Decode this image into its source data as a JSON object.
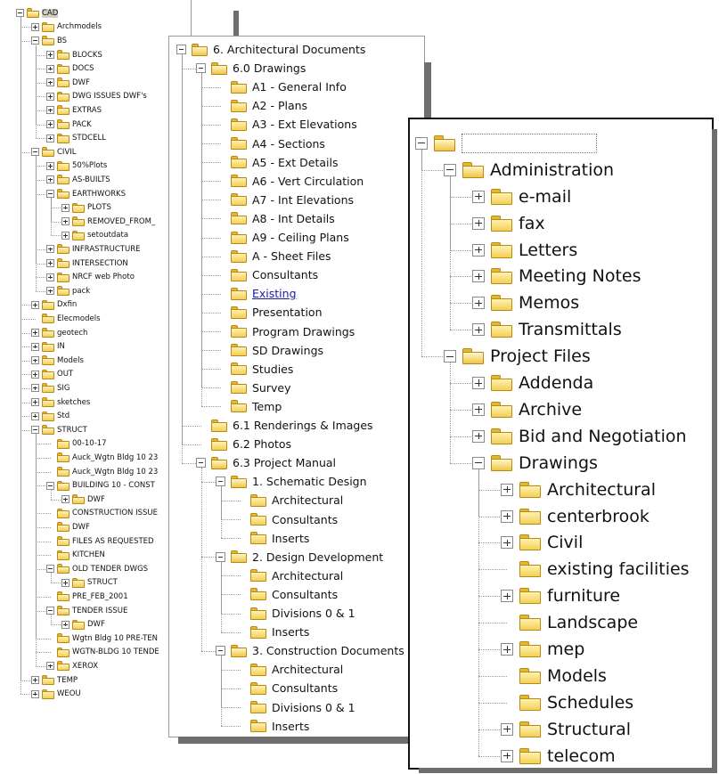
{
  "left_panel": {
    "items": [
      {
        "label": "CAD",
        "depth": 0,
        "toggle": "minus",
        "highlight": true
      },
      {
        "label": "Archmodels",
        "depth": 1,
        "toggle": "plus"
      },
      {
        "label": "BS",
        "depth": 1,
        "toggle": "minus"
      },
      {
        "label": "BLOCKS",
        "depth": 2,
        "toggle": "plus"
      },
      {
        "label": "DOCS",
        "depth": 2,
        "toggle": "plus"
      },
      {
        "label": "DWF",
        "depth": 2,
        "toggle": "plus"
      },
      {
        "label": "DWG ISSUES DWF's",
        "depth": 2,
        "toggle": "plus"
      },
      {
        "label": "EXTRAS",
        "depth": 2,
        "toggle": "plus"
      },
      {
        "label": "PACK",
        "depth": 2,
        "toggle": "plus"
      },
      {
        "label": "STDCELL",
        "depth": 2,
        "toggle": "plus"
      },
      {
        "label": "CIVIL",
        "depth": 1,
        "toggle": "minus"
      },
      {
        "label": "50%Plots",
        "depth": 2,
        "toggle": "plus"
      },
      {
        "label": "AS-BUILTS",
        "depth": 2,
        "toggle": "plus"
      },
      {
        "label": "EARTHWORKS",
        "depth": 2,
        "toggle": "minus"
      },
      {
        "label": "PLOTS",
        "depth": 3,
        "toggle": "plus"
      },
      {
        "label": "REMOVED_FROM_",
        "depth": 3,
        "toggle": "plus"
      },
      {
        "label": "setoutdata",
        "depth": 3,
        "toggle": "plus"
      },
      {
        "label": "INFRASTRUCTURE",
        "depth": 2,
        "toggle": "plus"
      },
      {
        "label": "INTERSECTION",
        "depth": 2,
        "toggle": "plus"
      },
      {
        "label": "NRCF web Photo",
        "depth": 2,
        "toggle": "plus"
      },
      {
        "label": "pack",
        "depth": 2,
        "toggle": "plus"
      },
      {
        "label": "Dxfin",
        "depth": 1,
        "toggle": "plus"
      },
      {
        "label": "Elecmodels",
        "depth": 1,
        "toggle": "none"
      },
      {
        "label": "geotech",
        "depth": 1,
        "toggle": "plus"
      },
      {
        "label": "IN",
        "depth": 1,
        "toggle": "plus"
      },
      {
        "label": "Models",
        "depth": 1,
        "toggle": "plus"
      },
      {
        "label": "OUT",
        "depth": 1,
        "toggle": "plus"
      },
      {
        "label": "SIG",
        "depth": 1,
        "toggle": "plus"
      },
      {
        "label": "sketches",
        "depth": 1,
        "toggle": "plus"
      },
      {
        "label": "Std",
        "depth": 1,
        "toggle": "plus"
      },
      {
        "label": "STRUCT",
        "depth": 1,
        "toggle": "minus"
      },
      {
        "label": "00-10-17",
        "depth": 2,
        "toggle": "none"
      },
      {
        "label": "Auck_Wgtn Bldg 10 23",
        "depth": 2,
        "toggle": "none"
      },
      {
        "label": "Auck_Wgtn Bldg 10 23",
        "depth": 2,
        "toggle": "none"
      },
      {
        "label": "BUILDING 10 - CONST",
        "depth": 2,
        "toggle": "minus"
      },
      {
        "label": "DWF",
        "depth": 3,
        "toggle": "plus"
      },
      {
        "label": "CONSTRUCTION ISSUE",
        "depth": 2,
        "toggle": "none"
      },
      {
        "label": "DWF",
        "depth": 2,
        "toggle": "none"
      },
      {
        "label": "FILES AS REQUESTED",
        "depth": 2,
        "toggle": "none"
      },
      {
        "label": "KITCHEN",
        "depth": 2,
        "toggle": "none"
      },
      {
        "label": "OLD TENDER DWGS",
        "depth": 2,
        "toggle": "minus"
      },
      {
        "label": "STRUCT",
        "depth": 3,
        "toggle": "plus"
      },
      {
        "label": "PRE_FEB_2001",
        "depth": 2,
        "toggle": "none"
      },
      {
        "label": "TENDER ISSUE",
        "depth": 2,
        "toggle": "minus"
      },
      {
        "label": "DWF",
        "depth": 3,
        "toggle": "plus"
      },
      {
        "label": "Wgtn Bldg 10 PRE-TEN",
        "depth": 2,
        "toggle": "none"
      },
      {
        "label": "WGTN-BLDG 10 TENDE",
        "depth": 2,
        "toggle": "none"
      },
      {
        "label": "XEROX",
        "depth": 2,
        "toggle": "plus"
      },
      {
        "label": "TEMP",
        "depth": 1,
        "toggle": "plus"
      },
      {
        "label": "WEOU",
        "depth": 1,
        "toggle": "plus"
      }
    ]
  },
  "middle_panel": {
    "items": [
      {
        "label": "6. Architectural Documents",
        "depth": 0,
        "toggle": "minus"
      },
      {
        "label": "6.0 Drawings",
        "depth": 1,
        "toggle": "minus"
      },
      {
        "label": "A1 - General Info",
        "depth": 2,
        "toggle": "none"
      },
      {
        "label": "A2 - Plans",
        "depth": 2,
        "toggle": "none"
      },
      {
        "label": "A3 - Ext Elevations",
        "depth": 2,
        "toggle": "none"
      },
      {
        "label": "A4 - Sections",
        "depth": 2,
        "toggle": "none"
      },
      {
        "label": "A5 - Ext Details",
        "depth": 2,
        "toggle": "none"
      },
      {
        "label": "A6 - Vert Circulation",
        "depth": 2,
        "toggle": "none"
      },
      {
        "label": "A7 - Int Elevations",
        "depth": 2,
        "toggle": "none"
      },
      {
        "label": "A8 - Int Details",
        "depth": 2,
        "toggle": "none"
      },
      {
        "label": "A9 - Ceiling Plans",
        "depth": 2,
        "toggle": "none"
      },
      {
        "label": "A - Sheet Files",
        "depth": 2,
        "toggle": "none"
      },
      {
        "label": "Consultants",
        "depth": 2,
        "toggle": "none"
      },
      {
        "label": "Existing",
        "depth": 2,
        "toggle": "none",
        "link": true
      },
      {
        "label": "Presentation",
        "depth": 2,
        "toggle": "none"
      },
      {
        "label": "Program Drawings",
        "depth": 2,
        "toggle": "none"
      },
      {
        "label": "SD Drawings",
        "depth": 2,
        "toggle": "none"
      },
      {
        "label": "Studies",
        "depth": 2,
        "toggle": "none"
      },
      {
        "label": "Survey",
        "depth": 2,
        "toggle": "none"
      },
      {
        "label": "Temp",
        "depth": 2,
        "toggle": "none"
      },
      {
        "label": "6.1 Renderings & Images",
        "depth": 1,
        "toggle": "none"
      },
      {
        "label": "6.2 Photos",
        "depth": 1,
        "toggle": "none"
      },
      {
        "label": "6.3 Project Manual",
        "depth": 1,
        "toggle": "minus"
      },
      {
        "label": "1. Schematic Design",
        "depth": 2,
        "toggle": "minus"
      },
      {
        "label": "Architectural",
        "depth": 3,
        "toggle": "none"
      },
      {
        "label": "Consultants",
        "depth": 3,
        "toggle": "none"
      },
      {
        "label": "Inserts",
        "depth": 3,
        "toggle": "none"
      },
      {
        "label": "2. Design Development",
        "depth": 2,
        "toggle": "minus"
      },
      {
        "label": "Architectural",
        "depth": 3,
        "toggle": "none"
      },
      {
        "label": "Consultants",
        "depth": 3,
        "toggle": "none"
      },
      {
        "label": "Divisions 0 & 1",
        "depth": 3,
        "toggle": "none"
      },
      {
        "label": "Inserts",
        "depth": 3,
        "toggle": "none"
      },
      {
        "label": "3. Construction Documents",
        "depth": 2,
        "toggle": "minus"
      },
      {
        "label": "Architectural",
        "depth": 3,
        "toggle": "none"
      },
      {
        "label": "Consultants",
        "depth": 3,
        "toggle": "none"
      },
      {
        "label": "Divisions 0 & 1",
        "depth": 3,
        "toggle": "none"
      },
      {
        "label": "Inserts",
        "depth": 3,
        "toggle": "none"
      }
    ]
  },
  "right_panel": {
    "items": [
      {
        "label": "",
        "depth": 0,
        "toggle": "minus",
        "root": true
      },
      {
        "label": "Administration",
        "depth": 1,
        "toggle": "minus"
      },
      {
        "label": "e-mail",
        "depth": 2,
        "toggle": "plus"
      },
      {
        "label": "fax",
        "depth": 2,
        "toggle": "plus"
      },
      {
        "label": "Letters",
        "depth": 2,
        "toggle": "plus"
      },
      {
        "label": "Meeting Notes",
        "depth": 2,
        "toggle": "plus"
      },
      {
        "label": "Memos",
        "depth": 2,
        "toggle": "plus"
      },
      {
        "label": "Transmittals",
        "depth": 2,
        "toggle": "plus"
      },
      {
        "label": "Project Files",
        "depth": 1,
        "toggle": "minus"
      },
      {
        "label": "Addenda",
        "depth": 2,
        "toggle": "plus"
      },
      {
        "label": "Archive",
        "depth": 2,
        "toggle": "plus"
      },
      {
        "label": "Bid and Negotiation",
        "depth": 2,
        "toggle": "plus"
      },
      {
        "label": "Drawings",
        "depth": 2,
        "toggle": "minus"
      },
      {
        "label": "Architectural",
        "depth": 3,
        "toggle": "plus"
      },
      {
        "label": "centerbrook",
        "depth": 3,
        "toggle": "plus"
      },
      {
        "label": "Civil",
        "depth": 3,
        "toggle": "plus"
      },
      {
        "label": "existing facilities",
        "depth": 3,
        "toggle": "none"
      },
      {
        "label": "furniture",
        "depth": 3,
        "toggle": "plus"
      },
      {
        "label": "Landscape",
        "depth": 3,
        "toggle": "none"
      },
      {
        "label": "mep",
        "depth": 3,
        "toggle": "plus"
      },
      {
        "label": "Models",
        "depth": 3,
        "toggle": "none"
      },
      {
        "label": "Schedules",
        "depth": 3,
        "toggle": "none"
      },
      {
        "label": "Structural",
        "depth": 3,
        "toggle": "plus"
      },
      {
        "label": "telecom",
        "depth": 3,
        "toggle": "plus"
      }
    ]
  }
}
